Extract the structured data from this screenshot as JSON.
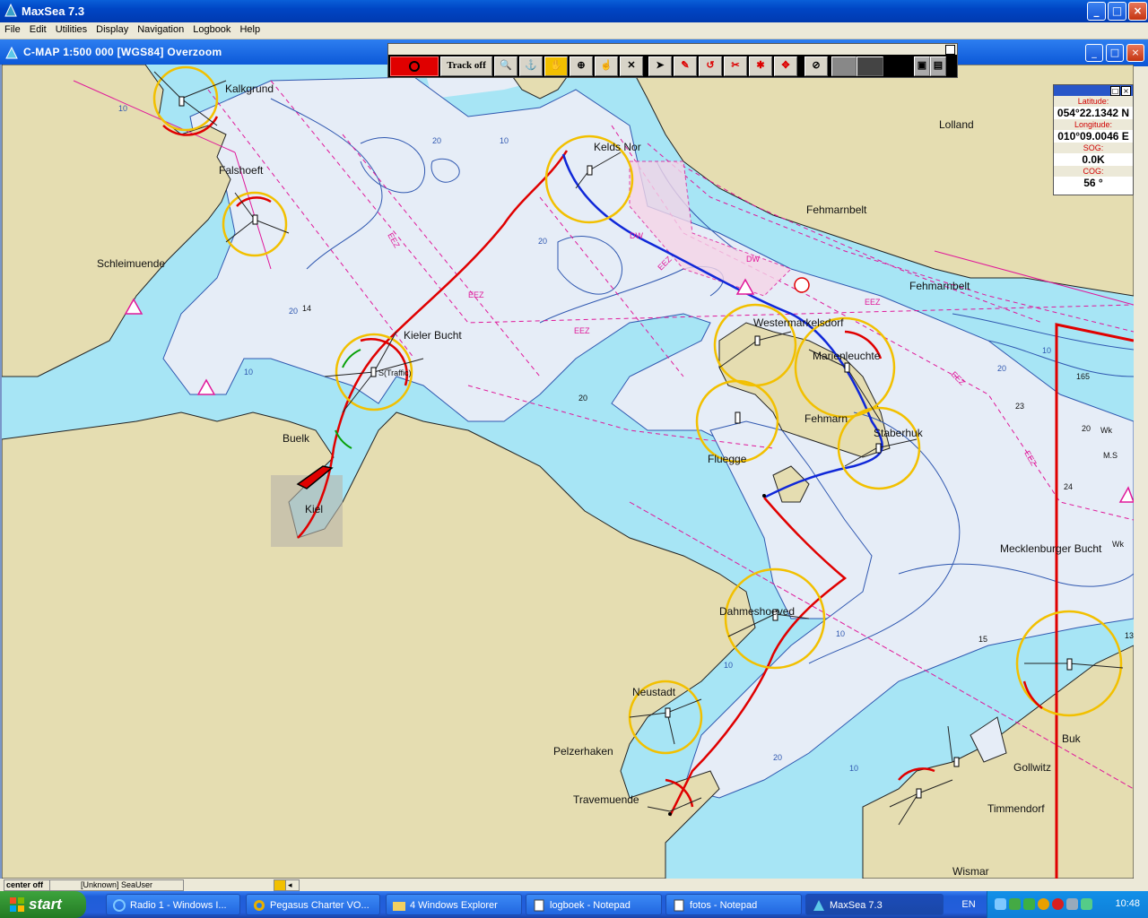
{
  "window": {
    "title": "MaxSea 7.3"
  },
  "menu": [
    "File",
    "Edit",
    "Utilities",
    "Display",
    "Navigation",
    "Logbook",
    "Help"
  ],
  "chart_window": {
    "title": "C-MAP  1:500 000 [WGS84]    Overzoom"
  },
  "toolbar": {
    "track_label": "Track off"
  },
  "gps": {
    "lat_label": "Latitude:",
    "lat": "054°22.1342 N",
    "lon_label": "Longitude:",
    "lon": "010°09.0046 E",
    "sog_label": "SOG:",
    "sog": "0.0K",
    "cog_label": "COG:",
    "cog": "56 °"
  },
  "map_labels": {
    "kalkgrund": "Kalkgrund",
    "falshoeft": "Falshoeft",
    "schleimuende": "Schleimuende",
    "kieler_bucht": "Kieler Bucht",
    "traffic": "S(Traffic)",
    "buelk": "Buelk",
    "kiel": "Kiel",
    "kelds_nor": "Kelds Nor",
    "lolland": "Lolland",
    "fehmarnbelt1": "Fehmarnbelt",
    "fehmarnbelt2": "Fehmarnbelt",
    "westermarkelsdorf": "Westermarkelsdorf",
    "marienleuchte": "Marienleuchte",
    "fehmarn": "Fehmarn",
    "staberhuk": "Staberhuk",
    "fluegge": "Fluegge",
    "mecklenburger_bucht": "Mecklenburger Bucht",
    "dahmeshoeved": "Dahmeshoeved",
    "neustadt": "Neustadt",
    "pelzerhaken": "Pelzerhaken",
    "travemuende": "Travemuende",
    "buk": "Buk",
    "gollwitz": "Gollwitz",
    "timmendorf": "Timmendorf",
    "wismar": "Wismar",
    "ms": "M.S",
    "wk1": "Wk",
    "wk2": "Wk"
  },
  "depths": {
    "d14": "14",
    "d20": "20",
    "d23": "23",
    "d24": "24",
    "d165": "165",
    "d15": "15",
    "d13": "13",
    "d20b": "20"
  },
  "status": {
    "center": "center off",
    "user": "[Unknown] SeaUser"
  },
  "taskbar": {
    "start": "start",
    "items": [
      "Radio 1 - Windows I...",
      "Pegasus Charter VO...",
      "4 Windows Explorer",
      "logboek - Notepad",
      "fotos - Notepad",
      "MaxSea 7.3"
    ],
    "lang": "EN",
    "clock": "10:48"
  },
  "colors": {
    "land": "#e5ddb1",
    "shallow": "#a7e5f5",
    "deep": "#e6edf7",
    "route_red": "#e00000",
    "route_blue": "#1028d8",
    "range_yellow": "#f2c000",
    "contour": "#3058b0",
    "eez": "#e0189a"
  }
}
